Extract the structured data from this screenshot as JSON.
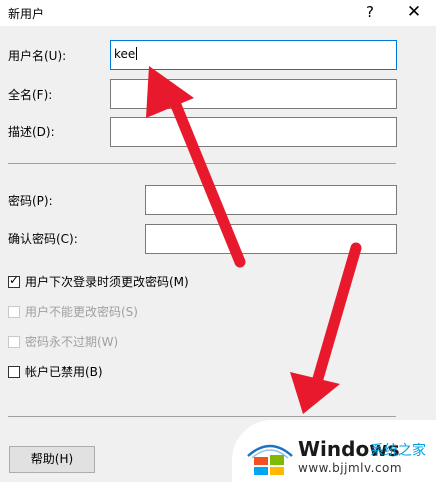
{
  "window": {
    "title": "新用户",
    "help_glyph": "?",
    "close_glyph": "✕"
  },
  "fields": {
    "username_label": "用户名(U):",
    "username_value": "kee",
    "fullname_label": "全名(F):",
    "fullname_value": "",
    "description_label": "描述(D):",
    "description_value": "",
    "password_label": "密码(P):",
    "password_value": "",
    "confirm_label": "确认密码(C):",
    "confirm_value": ""
  },
  "options": [
    {
      "label": "用户下次登录时须更改密码(M)",
      "checked": true,
      "enabled": true
    },
    {
      "label": "用户不能更改密码(S)",
      "checked": false,
      "enabled": false
    },
    {
      "label": "密码永不过期(W)",
      "checked": false,
      "enabled": false
    },
    {
      "label": "帐户已禁用(B)",
      "checked": false,
      "enabled": true
    }
  ],
  "buttons": {
    "help_label": "帮助(H)"
  },
  "watermark": {
    "brand": "Windows",
    "cn_text": "系统之家",
    "url": "www.bjjmlv.com"
  },
  "colors": {
    "arrow": "#e8192c",
    "focus_border": "#0078d7",
    "window_bg": "#f0f0f0"
  }
}
